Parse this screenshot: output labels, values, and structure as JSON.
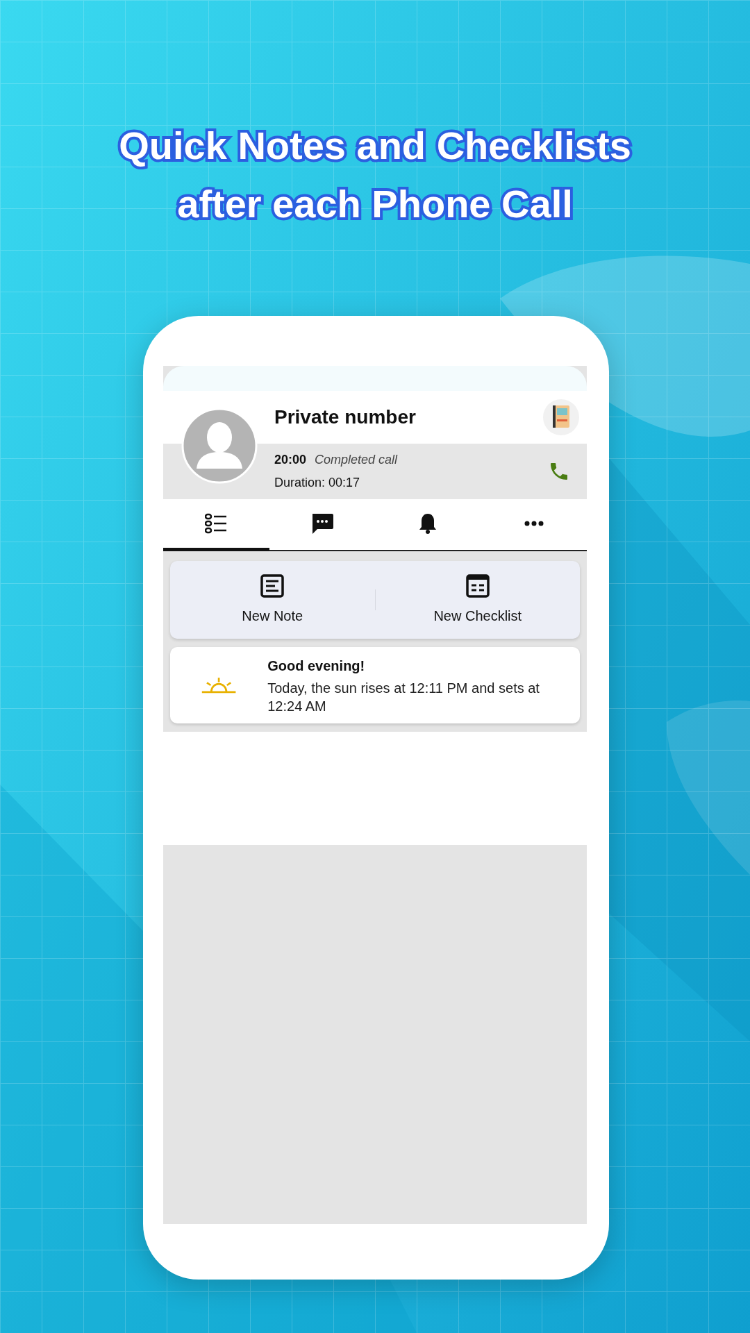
{
  "headline": [
    "Quick Notes and Checklists",
    "after each Phone Call"
  ],
  "contact": {
    "name": "Private number",
    "time": "20:00",
    "call_status": "Completed call",
    "duration": "Duration: 00:17"
  },
  "tabs": [
    {
      "kind": "list",
      "selected": true
    },
    {
      "kind": "message",
      "selected": false
    },
    {
      "kind": "bell",
      "selected": false
    },
    {
      "kind": "more",
      "selected": false
    }
  ],
  "actions": [
    {
      "kind": "note",
      "label": "New Note"
    },
    {
      "kind": "checklist",
      "label": "New Checklist"
    }
  ],
  "greeting": {
    "title": "Good evening!",
    "text": "Today, the sun rises at 12:11 PM and sets at 12:24 AM"
  }
}
